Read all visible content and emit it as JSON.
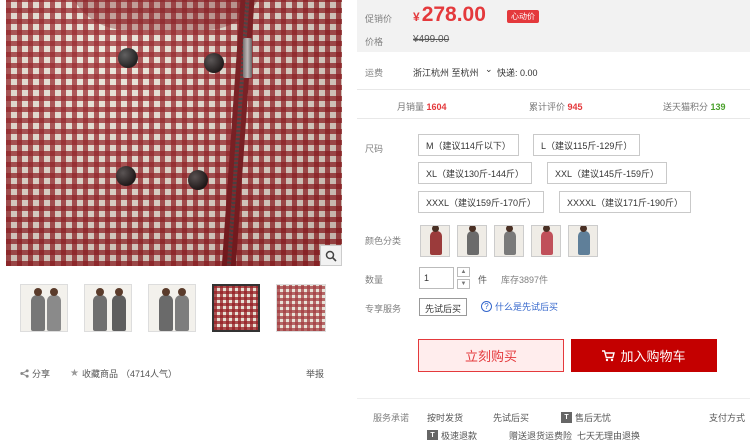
{
  "gallery": {
    "thumbnails": [
      {
        "name": "thumb-1"
      },
      {
        "name": "thumb-2"
      },
      {
        "name": "thumb-3"
      },
      {
        "name": "thumb-4"
      },
      {
        "name": "thumb-5"
      }
    ],
    "active_thumb": 4,
    "share_label": "分享",
    "favorite_label": "收藏商品",
    "favorite_count": "（4714人气）",
    "report_label": "举报"
  },
  "price": {
    "promo_label": "促销价",
    "currency": "¥",
    "promo_value": "278.00",
    "heart_tag": "心动价",
    "orig_label": "价格",
    "orig_value": "¥499.00"
  },
  "shipping": {
    "label": "运费",
    "route": "浙江杭州  至杭州",
    "express": "快递: 0.00"
  },
  "stats": {
    "monthly_label": "月销量",
    "monthly_value": "1604",
    "reviews_label": "累计评价",
    "reviews_value": "945",
    "points_label": "送天猫积分",
    "points_value": "139"
  },
  "sku": {
    "size_label": "尺码",
    "sizes": [
      "M（建议114斤以下）",
      "L（建议115斤-129斤）",
      "XL（建议130斤-144斤）",
      "XXL（建议145斤-159斤）",
      "XXXL（建议159斤-170斤）",
      "XXXXL（建议171斤-190斤）"
    ],
    "color_label": "颜色分类",
    "quantity_label": "数量",
    "quantity_value": "1",
    "unit": "件",
    "stock": "库存3897件",
    "service_label": "专享服务",
    "service_option": "先试后买",
    "service_help": "什么是先试后买"
  },
  "actions": {
    "buy_now": "立刻购买",
    "add_cart": "加入购物车"
  },
  "promise": {
    "label": "服务承诺",
    "items": [
      "按时发货",
      "先试后买",
      "售后无忧",
      "支付方式",
      "极速退款",
      "赠送退货运费险",
      "七天无理由退换"
    ]
  },
  "colors": {
    "accent_red": "#e4393c",
    "cart_red": "#c40000",
    "points_green": "#4aa02c",
    "link_blue": "#3366cc"
  }
}
